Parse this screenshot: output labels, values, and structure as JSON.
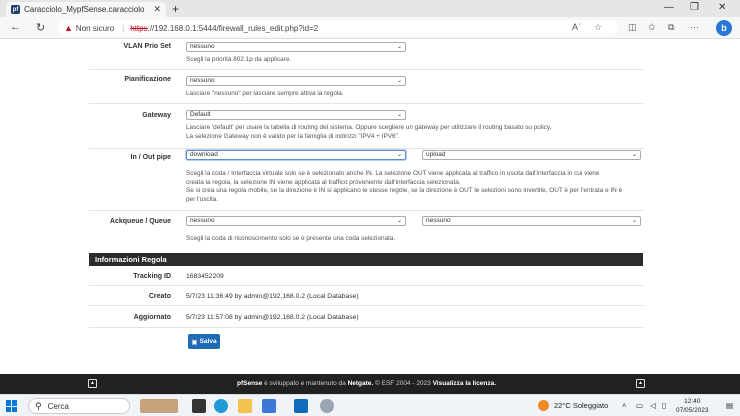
{
  "browser": {
    "tab_title": "Caracciolo_MypfSense.caracciolo",
    "favicon_text": "pf",
    "url_warning": "Non sicuro",
    "url_scheme": "https",
    "url_rest": "://192.168.0.1:5444/firewall_rules_edit.php?id=2",
    "new_tab_symbol": "+",
    "back_symbol": "←",
    "refresh_symbol": "↻",
    "read_aloud": "Aʾ"
  },
  "form": {
    "vlan": {
      "label": "VLAN Prio Set",
      "value": "nessuno",
      "help": "Scegli la priorità 802.1p da applicare."
    },
    "schedule": {
      "label": "Pianificazione",
      "value": "nessuno",
      "help": "Lasciare \"nessuno\" per lasciare sempre attiva la regola."
    },
    "gateway": {
      "label": "Gateway",
      "value": "Default",
      "help1": "Lasciare 'default' per usare la tabella di routing del sistema. Oppure scegliere un gateway per utilizzare il routing basato su policy.",
      "help2": "La selezione Gateway non è valido per la famiglia di indirizzi \"IPV4 + IPV6\"."
    },
    "pipe": {
      "label": "In / Out pipe",
      "in_value": "download",
      "out_value": "upload",
      "help1": "Scegli la coda / Interfaccia virtuale solo se è selezionato anche IN. La selezione OUT viene applicata al traffico in uscita dall'interfaccia in cui viene",
      "help2": "creata la regola, la selezione IN viene applicata al traffico proveniente dall'interfaccia selezionata.",
      "help3": "Se si crea una regola mobile, se la direzione è IN si applicano le stesse regole, se la direzione è OUT le selezioni sono invertite, OUT è per l'entrata e IN è",
      "help4": "per l'uscita."
    },
    "ackqueue": {
      "label": "Ackqueue / Queue",
      "ack_value": "nessuno",
      "queue_value": "nessuno",
      "help": "Scegli la coda di riconoscimento solo se è presente una coda selezionata."
    }
  },
  "info": {
    "header": "Informazioni Regola",
    "tracking_label": "Tracking ID",
    "tracking_value": "1683452209",
    "created_label": "Creato",
    "created_value": "5/7/23 11:36:49 by admin@192.168.0.2 (Local Database)",
    "updated_label": "Aggiornato",
    "updated_value": "5/7/23 11:57:08 by admin@192.168.0.2 (Local Database)"
  },
  "save_label": "Salva",
  "footer": {
    "brand": "pfSense",
    "mid": " è sviluppato e mantenuto da ",
    "company": "Netgate.",
    "copy": " © ESF 2004 - 2023 ",
    "license": "Visualizza la licenza."
  },
  "taskbar": {
    "search_label": "Cerca",
    "weather": "22°C  Soleggiato",
    "time": "12:40",
    "date": "07/05/2023"
  },
  "colors": {
    "section_header": "#2c2c2c",
    "save_button": "#1e6cb7",
    "footer": "#212121",
    "insecure_red": "#c50f1f"
  }
}
